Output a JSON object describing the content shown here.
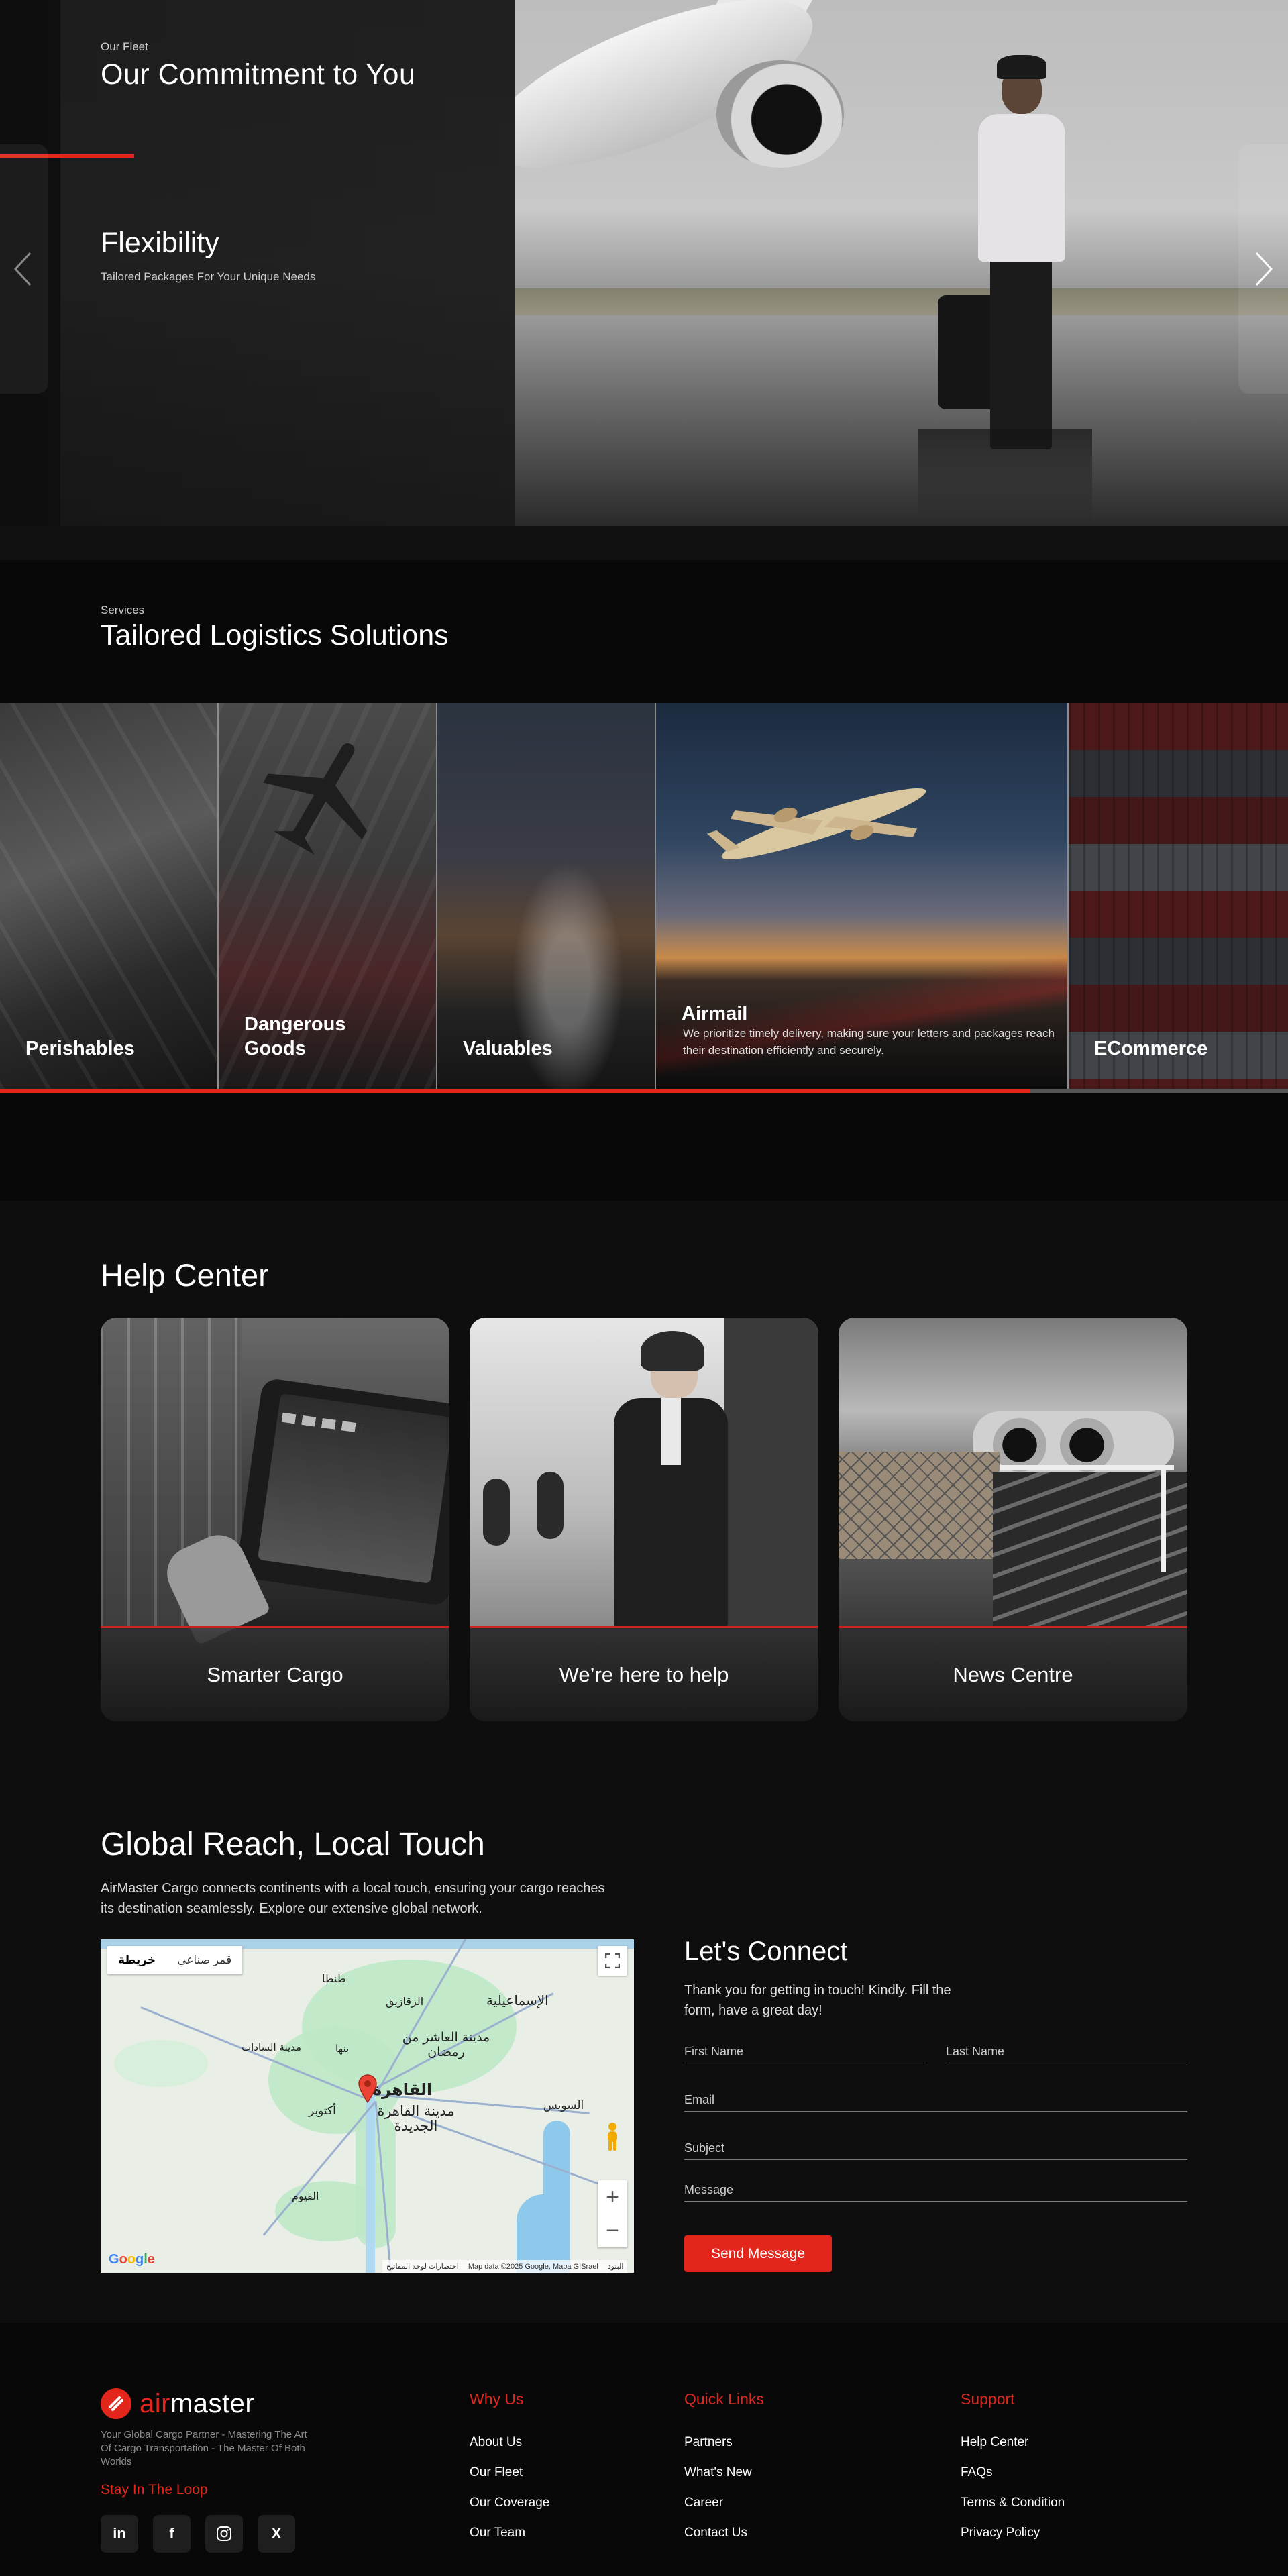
{
  "fleet": {
    "eyebrow": "Our Fleet",
    "title": "Our Commitment to You",
    "slide_title": "Flexibility",
    "slide_subtitle": "Tailored Packages For Your Unique Needs",
    "prev_icon": "chevron-left-icon",
    "next_icon": "chevron-right-icon"
  },
  "services": {
    "eyebrow": "Services",
    "title": "Tailored Logistics Solutions",
    "items": [
      {
        "label": "Perishables"
      },
      {
        "label": "Dangerous Goods"
      },
      {
        "label": "Valuables"
      },
      {
        "label": "Airmail",
        "description": "We prioritize timely delivery, making sure your letters and packages reach their destination efficiently and securely."
      },
      {
        "label": "ECommerce"
      }
    ],
    "active_index": 3,
    "progress": 0.8
  },
  "help": {
    "title": "Help Center",
    "cards": [
      {
        "label": "Smarter Cargo"
      },
      {
        "label": "We’re here to help"
      },
      {
        "label": "News Centre"
      }
    ]
  },
  "reach": {
    "title": "Global Reach, Local Touch",
    "text": "AirMaster Cargo connects continents with a local touch, ensuring your cargo reaches its destination seamlessly. Explore our extensive global network.",
    "map": {
      "toggle_map": "خريطة",
      "toggle_satellite": "قمر صناعي",
      "cities": [
        "القاهرة",
        "مدينة القاهرة الجديدة",
        "مدينة العاشر من رمضان",
        "الإسماعيلية",
        "السويس",
        "طنطا",
        "الزقازيق",
        "الفيوم",
        "مدينة السادات",
        "بنها",
        "أكتوبر"
      ],
      "attribution": "Map data ©2025 Google, Mapa GISrael",
      "attribution_shortcuts": "اختصارات لوحة المفاتيح",
      "attribution_terms": "البنود",
      "zoom_in": "+",
      "zoom_out": "−"
    }
  },
  "connect": {
    "title": "Let's Connect",
    "text": "Thank you for getting in touch! Kindly. Fill the form, have a great day!",
    "first_name": "First Name",
    "last_name": "Last Name",
    "email": "Email",
    "subject": "Subject",
    "message": "Message",
    "submit": "Send Message"
  },
  "footer": {
    "brand_air": "air",
    "brand_master": "master",
    "tagline": "Your Global Cargo Partner - Mastering The Art Of Cargo Transportation - The Master Of Both Worlds",
    "loop_title": "Stay In The Loop",
    "socials": [
      "in",
      "f",
      "ig",
      "X"
    ],
    "columns": [
      {
        "heading": "Why Us",
        "links": [
          "About Us",
          "Our Fleet",
          "Our Coverage",
          "Our Team"
        ]
      },
      {
        "heading": "Quick Links",
        "links": [
          "Partners",
          "What's New",
          "Career",
          "Contact Us"
        ]
      },
      {
        "heading": "Support",
        "links": [
          "Help Center",
          "FAQs",
          "Terms & Condition",
          "Privacy Policy"
        ]
      }
    ]
  },
  "colors": {
    "accent": "#e3261c",
    "background": "#0e0e0e"
  }
}
